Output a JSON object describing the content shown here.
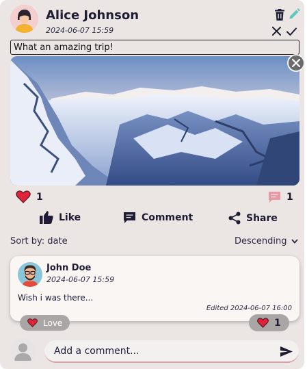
{
  "post": {
    "author": "Alice Johnson",
    "timestamp": "2024-06-07 15:59",
    "text": "What an amazing trip!",
    "likes_count": "1",
    "comments_count": "1"
  },
  "actions": {
    "like_label": "Like",
    "comment_label": "Comment",
    "share_label": "Share"
  },
  "sort": {
    "label": "Sort by: date",
    "order": "Descending"
  },
  "comment": {
    "author": "John Doe",
    "timestamp": "2024-06-07 15:59",
    "text": "Wish i was there...",
    "edited": "Edited 2024-06-07 16:00",
    "love_label": "Love",
    "reaction_count": "1"
  },
  "composer": {
    "placeholder": "Add a comment..."
  },
  "colors": {
    "heart": "#e0233b",
    "edit_pencil": "#5ec6c0",
    "comment_badge": "#e89aa4",
    "text_dark": "#1e1b33",
    "card_bg": "#ebe6e4"
  },
  "icons": [
    "user-avatar-icon",
    "trash-icon",
    "pencil-icon",
    "close-icon",
    "check-icon",
    "heart-icon",
    "comment-icon",
    "thumbs-up-icon",
    "share-icon",
    "chevron-down-icon",
    "send-icon"
  ]
}
